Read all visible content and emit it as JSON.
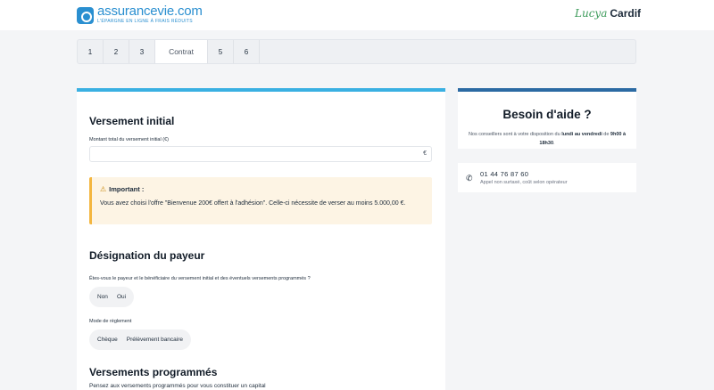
{
  "header": {
    "logo_name": "assurancevie.com",
    "logo_tagline": "L'ÉPARGNE EN LIGNE À FRAIS RÉDUITS",
    "partner_script": "Lucya",
    "partner_name": "Cardif"
  },
  "stepper": {
    "steps": [
      "1",
      "2",
      "3",
      "Contrat",
      "5",
      "6"
    ]
  },
  "versement_initial": {
    "title": "Versement initial",
    "amount_label": "Montant total du versement initial (€)",
    "amount_value": "",
    "currency_symbol": "€",
    "alert_title": "Important :",
    "alert_text": "Vous avez choisi l'offre \"Bienvenue 200€ offert à l'adhésion\". Celle-ci nécessite de verser au moins 5.000,00 €."
  },
  "designation": {
    "title": "Désignation du payeur",
    "question": "Êtes-vous le payeur et le bénéficiaire du versement initial et des éventuels versements programmés ?",
    "options": [
      "Non",
      "Oui"
    ],
    "payment_label": "Mode de règlement",
    "payment_options": [
      "Chèque",
      "Prélèvement bancaire"
    ]
  },
  "versements_programmes": {
    "title": "Versements programmés",
    "subtitle": "Pensez aux versements programmés pour vous constituer un capital"
  },
  "help": {
    "title": "Besoin d'aide ?",
    "text_before": "Nos conseillers sont à votre disposition du ",
    "text_days": "lundi au vendredi",
    "text_middle": " de ",
    "text_hours": "9h00 à 18h30",
    "text_end": ".",
    "phone": "01 44 76 87 60",
    "phone_note": "Appel non surtaxé, coût selon opérateur"
  },
  "colors": {
    "primary_accent": "#3ab0e2",
    "help_accent": "#2b6aa3",
    "alert_border": "#f4b63f",
    "alert_bg": "#fdf4e4"
  }
}
